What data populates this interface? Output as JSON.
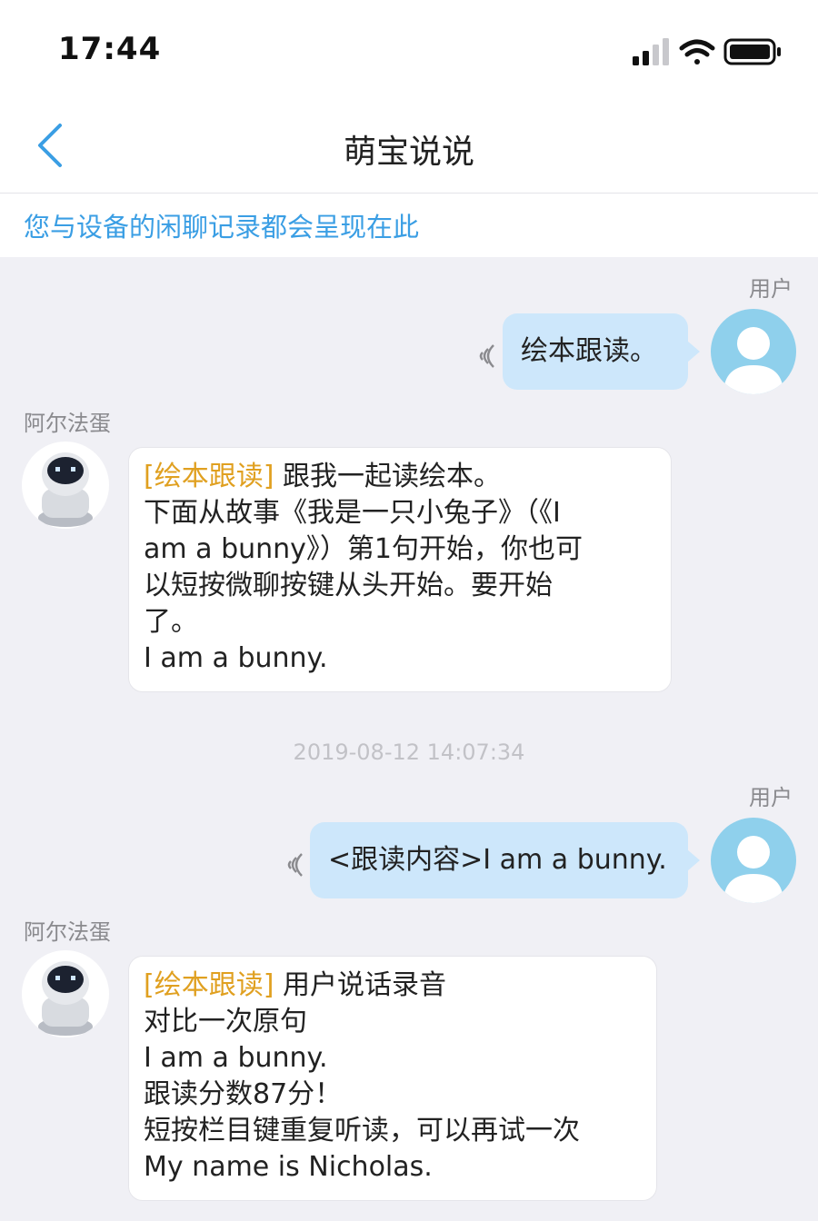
{
  "status_bar": {
    "time": "17:44",
    "icons": [
      "signal-icon",
      "wifi-icon",
      "battery-icon"
    ]
  },
  "nav": {
    "title": "萌宝说说",
    "back_icon": "chevron-left-icon",
    "accent": "#3a9ee4"
  },
  "notice": "您与设备的闲聊记录都会呈现在此",
  "timestamp": "2019-08-12 14:07:34",
  "messages": [
    {
      "sender": "用户",
      "text": "绘本跟读。"
    },
    {
      "sender": "阿尔法蛋",
      "tag": "[绘本跟读]",
      "lines": [
        "跟我一起读绘本。",
        "下面从故事《我是一只小兔子》（《I",
        "am a bunny》）第1句开始，你也可",
        "以短按微聊按键从头开始。要开始",
        "了。",
        "I am a bunny."
      ]
    },
    {
      "sender": "用户",
      "text": "<跟读内容>I am a bunny."
    },
    {
      "sender": "阿尔法蛋",
      "tag": "[绘本跟读]",
      "lines": [
        "用户说话录音",
        "对比一次原句",
        "I am a bunny.",
        "跟读分数87分！",
        "短按栏目键重复听读，可以再试一次",
        "My name is Nicholas."
      ]
    }
  ],
  "colors": {
    "user_bubble": "#cde7fb",
    "tag": "#e0a020",
    "avatar_user": "#8fd0ec"
  }
}
